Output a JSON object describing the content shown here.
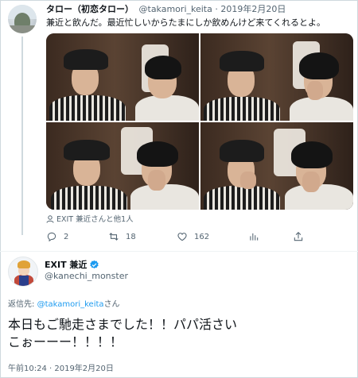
{
  "tweet1": {
    "display_name": "タロー（初恋タロー）",
    "handle_date": "@takamori_keita · 2019年2月20日",
    "text": "兼近と飲んだ。最近忙しいからたまにしか飲めんけど来てくれるとよ。",
    "media_tags": "EXIT 兼近さんと他1人",
    "actions": {
      "reply_count": "2",
      "retweet_count": "18",
      "like_count": "162"
    }
  },
  "tweet2": {
    "display_name": "EXIT 兼近",
    "handle": "@kanechi_monster",
    "reply_prefix": "返信先: ",
    "reply_handle": "@takamori_keita",
    "reply_suffix": "さん",
    "text_line1": "本日もご馳走さまでした！！パパ活さい",
    "text_line2": "こぉーーー！！！！",
    "timestamp": "午前10:24 · 2019年2月20日"
  },
  "colors": {
    "accent": "#1d9bf0",
    "secondary_text": "#536471",
    "primary_text": "#0f1419",
    "border": "#cfd9de"
  }
}
